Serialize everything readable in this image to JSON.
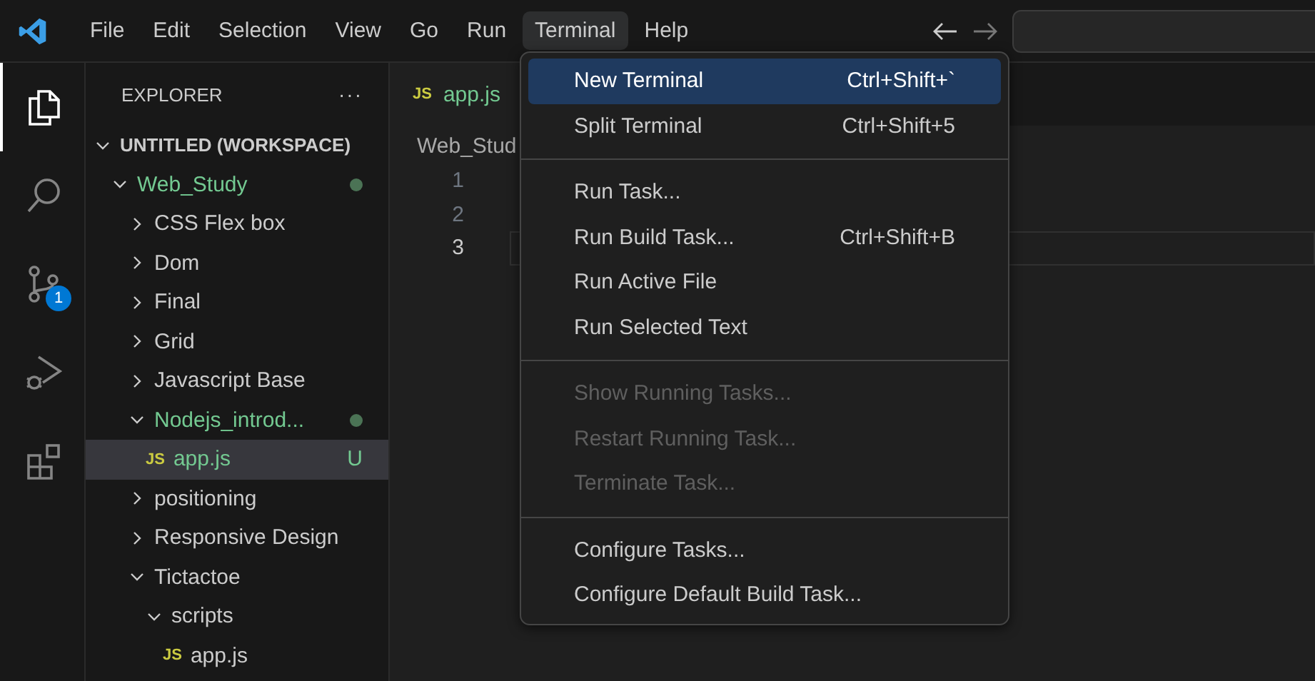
{
  "menubar": [
    {
      "label": "File",
      "selected": false
    },
    {
      "label": "Edit",
      "selected": false
    },
    {
      "label": "Selection",
      "selected": false
    },
    {
      "label": "View",
      "selected": false
    },
    {
      "label": "Go",
      "selected": false
    },
    {
      "label": "Run",
      "selected": false
    },
    {
      "label": "Terminal",
      "selected": true
    },
    {
      "label": "Help",
      "selected": false
    }
  ],
  "activity_bar": [
    {
      "kind": "explorer",
      "selected": true
    },
    {
      "kind": "search",
      "selected": false
    },
    {
      "kind": "source-control",
      "selected": false,
      "badge": "1"
    },
    {
      "kind": "run-debug",
      "selected": false
    },
    {
      "kind": "extensions",
      "selected": false
    }
  ],
  "sidebar": {
    "title": "EXPLORER",
    "more": "···",
    "tree": [
      {
        "label": "UNTITLED (WORKSPACE)",
        "kind": "root",
        "expanded": true,
        "children": [
          {
            "label": "Web_Study",
            "kind": "folder",
            "expanded": true,
            "untracked": true,
            "dot": true,
            "children": [
              {
                "label": "CSS Flex box",
                "kind": "folder",
                "expanded": false
              },
              {
                "label": "Dom",
                "kind": "folder",
                "expanded": false
              },
              {
                "label": "Final",
                "kind": "folder",
                "expanded": false
              },
              {
                "label": "Grid",
                "kind": "folder",
                "expanded": false
              },
              {
                "label": "Javascript Base",
                "kind": "folder",
                "expanded": false
              },
              {
                "label": "Nodejs_introd...",
                "kind": "folder",
                "expanded": true,
                "untracked": true,
                "dot": true,
                "children": [
                  {
                    "label": "app.js",
                    "kind": "file",
                    "icon": "JS",
                    "untracked": true,
                    "status": "U",
                    "selected": true
                  }
                ]
              },
              {
                "label": "positioning",
                "kind": "folder",
                "expanded": false
              },
              {
                "label": "Responsive Design",
                "kind": "folder",
                "expanded": false
              },
              {
                "label": "Tictactoe",
                "kind": "folder",
                "expanded": true,
                "children": [
                  {
                    "label": "scripts",
                    "kind": "folder",
                    "expanded": true,
                    "children": [
                      {
                        "label": "app.js",
                        "kind": "file",
                        "icon": "JS",
                        "selected": false
                      }
                    ]
                  }
                ]
              }
            ]
          }
        ]
      }
    ]
  },
  "editor": {
    "tab": {
      "icon": "JS",
      "label": "app.js"
    },
    "breadcrumb": "Web_Stud",
    "line_numbers": [
      "1",
      "2",
      "3"
    ]
  },
  "terminal_menu": [
    {
      "kind": "item",
      "label": "New Terminal",
      "shortcut": "Ctrl+Shift+`",
      "selected": true,
      "disabled": false
    },
    {
      "kind": "item",
      "label": "Split Terminal",
      "shortcut": "Ctrl+Shift+5",
      "selected": false,
      "disabled": false
    },
    {
      "kind": "separator"
    },
    {
      "kind": "item",
      "label": "Run Task...",
      "selected": false,
      "disabled": false
    },
    {
      "kind": "item",
      "label": "Run Build Task...",
      "shortcut": "Ctrl+Shift+B",
      "selected": false,
      "disabled": false
    },
    {
      "kind": "item",
      "label": "Run Active File",
      "selected": false,
      "disabled": false
    },
    {
      "kind": "item",
      "label": "Run Selected Text",
      "selected": false,
      "disabled": false
    },
    {
      "kind": "separator"
    },
    {
      "kind": "item",
      "label": "Show Running Tasks...",
      "selected": false,
      "disabled": true
    },
    {
      "kind": "item",
      "label": "Restart Running Task...",
      "selected": false,
      "disabled": true
    },
    {
      "kind": "item",
      "label": "Terminate Task...",
      "selected": false,
      "disabled": true
    },
    {
      "kind": "separator"
    },
    {
      "kind": "item",
      "label": "Configure Tasks...",
      "selected": false,
      "disabled": false
    },
    {
      "kind": "item",
      "label": "Configure Default Build Task...",
      "selected": false,
      "disabled": false
    }
  ]
}
